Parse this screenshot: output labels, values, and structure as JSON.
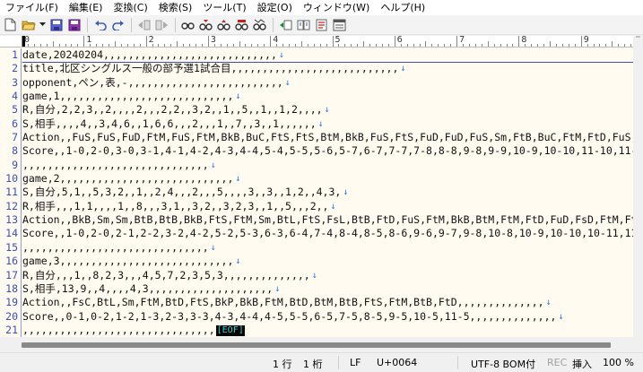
{
  "menu": [
    "ファイル(F)",
    "編集(E)",
    "変換(C)",
    "検索(S)",
    "ツール(T)",
    "設定(O)",
    "ウィンドウ(W)",
    "ヘルプ(H)"
  ],
  "toolbar_icons": [
    "new-file-icon",
    "open-folder-icon",
    "dropdown-arrow-icon",
    "save-icon",
    "save-all-icon",
    "undo-icon",
    "redo-icon",
    "jump-back-icon",
    "jump-forward-icon",
    "find-icon",
    "find-next-icon",
    "find-prev-icon",
    "replace-icon",
    "grep-icon",
    "tag-jump-icon",
    "compare-icon",
    "outline-icon",
    "window-list-icon",
    "help-icon"
  ],
  "ruler_numbers": [
    "0",
    "1",
    "2",
    "3",
    "4",
    "5",
    "6",
    "7",
    "8",
    "9",
    "10"
  ],
  "lines": [
    {
      "num": "1",
      "text": "date,20240204,,,,,,,,,,,,,,,,,,,,,,,,,,,,",
      "eol": "↓"
    },
    {
      "num": "2",
      "text": "title,北区シングルス一般の部予選1試合目,,,,,,,,,,,,,,,,,,,,,,,,,,,",
      "eol": "↓"
    },
    {
      "num": "3",
      "text": "opponent,ペン,表,-,,,,,,,,,,,,,,,,,,,,,,,,,",
      "eol": "↓"
    },
    {
      "num": "4",
      "text": "game,1,,,,,,,,,,,,,,,,,,,,,,,,,,,,",
      "eol": "↓"
    },
    {
      "num": "5",
      "text": "R,自分,2,2,3,,2,,,,2,,,2,2,,3,2,,1,,5,,1,,1,2,,,,",
      "eol": "↓"
    },
    {
      "num": "6",
      "text": "S,相手,,,,4,,3,4,6,,1,6,6,,,2,,,1,,7,,3,,1,,,,,,",
      "eol": "↓"
    },
    {
      "num": "7",
      "text": "Action,,FuS,FuS,FuD,FtM,FuS,FtM,BkB,BuC,FtS,FtS,BtM,BkB,FuS,FtS,FuD,FuD,FuS,Sm,FtB,BuC,FtM,FtD,FuS,FtB,",
      "eol": ""
    },
    {
      "num": "8",
      "text": "Score,,1-0,2-0,3-0,3-1,4-1,4-2,4-3,4-4,5-4,5-5,5-6,5-7,6-7,7-7,7-8,8-8,9-8,9-9,10-9,10-10,11-10,11-11,1",
      "eol": ""
    },
    {
      "num": "9",
      "text": ",,,,,,,,,,,,,,,,,,,,,,,,,,,,,,",
      "eol": "↓"
    },
    {
      "num": "10",
      "text": "game,2,,,,,,,,,,,,,,,,,,,,,,,,,,,,",
      "eol": "↓"
    },
    {
      "num": "11",
      "text": "S,自分,5,1,,5,3,2,,1,,2,4,,,2,,,5,,,,3,,3,,1,2,,4,3,",
      "eol": "↓"
    },
    {
      "num": "12",
      "text": "R,相手,,,1,1,,,,1,,8,,,3,1,,3,2,,3,2,3,,1,,5,,,2,,",
      "eol": "↓"
    },
    {
      "num": "13",
      "text": "Action,,BkB,Sm,Sm,BtB,BtB,BkB,FtS,FtM,Sm,BtL,FtS,FsL,BtB,FtD,FuS,FtM,BkB,BtM,FtM,FtD,FuD,FsD,FtM,FtM,Bt",
      "eol": ""
    },
    {
      "num": "14",
      "text": "Score,,1-0,2-0,2-1,2-2,3-2,4-2,5-2,5-3,6-3,6-4,7-4,8-4,8-5,8-6,9-6,9-7,9-8,10-8,10-9,10-10,10-11,11-11,",
      "eol": ""
    },
    {
      "num": "15",
      "text": ",,,,,,,,,,,,,,,,,,,,,,,,,,,,,,",
      "eol": "↓"
    },
    {
      "num": "16",
      "text": "game,3,,,,,,,,,,,,,,,,,,,,,,,,,,,,",
      "eol": "↓"
    },
    {
      "num": "17",
      "text": "R,自分,,,1,,8,2,3,,,4,5,7,2,3,5,3,,,,,,,,,,,,,,",
      "eol": "↓"
    },
    {
      "num": "18",
      "text": "S,相手,13,9,,4,,,,4,3,,,,,,,,,,,,,,,,,,,,",
      "eol": "↓"
    },
    {
      "num": "19",
      "text": "Action,,FsC,BtL,Sm,FtM,BtD,FtS,BkP,BkB,FtM,BtD,BtM,BtB,FtS,FtM,BtB,FtD,,,,,,,,,,,,,,",
      "eol": "↓"
    },
    {
      "num": "20",
      "text": "Score,,0-1,0-2,1-2,1-3,2-3,3-3,4-3,4-4,4-5,5-5,6-5,7-5,8-5,9-5,10-5,11-5,,,,,,,,,,,,,,",
      "eol": "↓"
    },
    {
      "num": "21",
      "text": ",,,,,,,,,,,,,,,,,,,,,,,,,,,,,,,",
      "eol": "",
      "eof": "[EOF]"
    }
  ],
  "status": {
    "line": "1 行",
    "col": "1 桁",
    "eol_type": "LF",
    "codepoint": "U+0064",
    "encoding": "UTF-8 BOM付",
    "rec": "REC",
    "insert_mode": "挿入",
    "zoom": "100 %"
  },
  "colors": {
    "line_number": "#3c4fb8",
    "eol_mark": "#2a7ae8",
    "eof_text": "#3fd2d2",
    "editor_bg": "#fffbf0"
  }
}
